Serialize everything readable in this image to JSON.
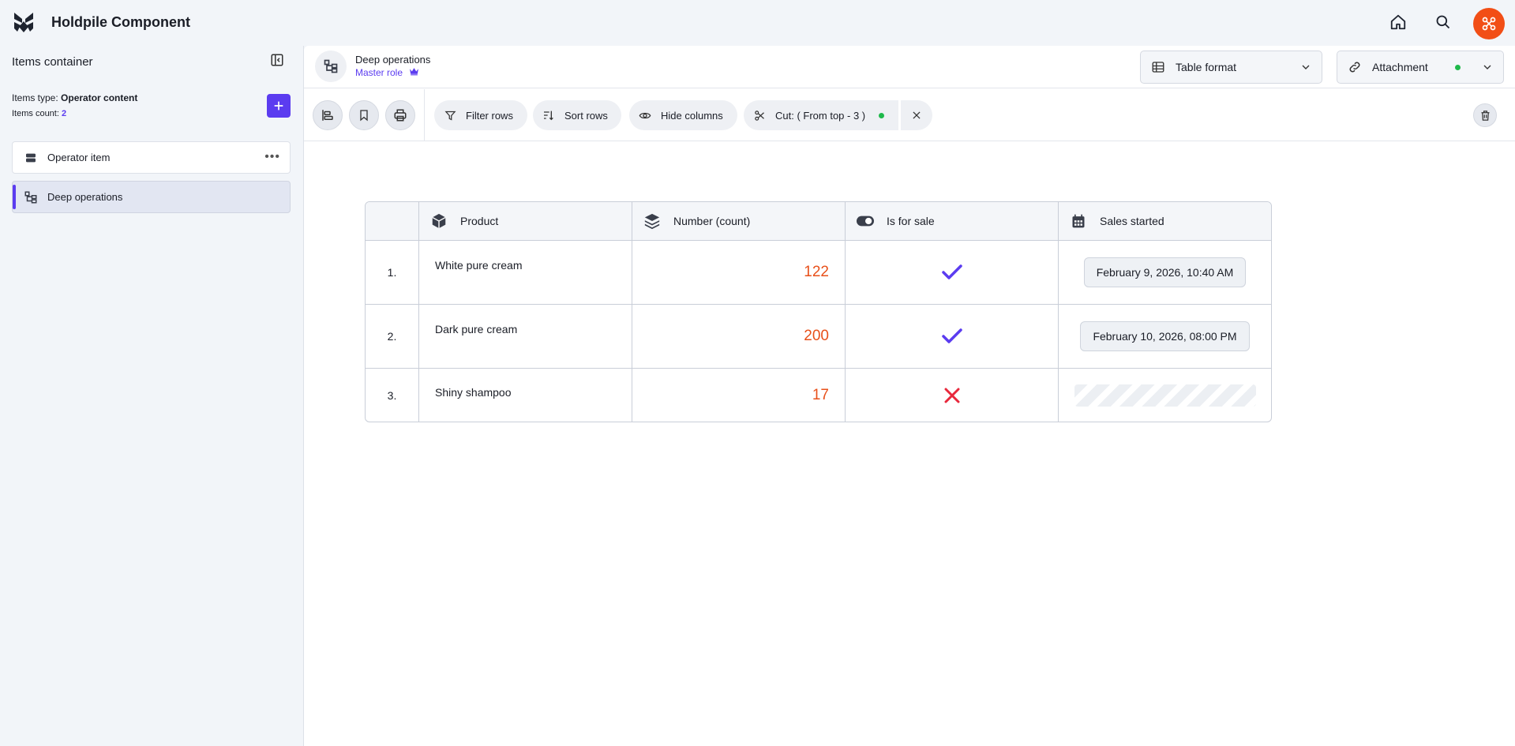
{
  "app": {
    "title": "Holdpile Component"
  },
  "sidebar": {
    "title": "Items container",
    "items_type_label": "Items type:",
    "items_type_value": "Operator content",
    "items_count_label": "Items count:",
    "items_count_value": "2",
    "items": [
      {
        "label": "Operator item",
        "icon": "database-icon"
      },
      {
        "label": "Deep operations",
        "icon": "hierarchy-icon",
        "active": true
      }
    ]
  },
  "header": {
    "title": "Deep operations",
    "role": "Master role",
    "format_select": "Table format",
    "attachment_select": "Attachment"
  },
  "toolbar": {
    "filter": "Filter rows",
    "sort": "Sort rows",
    "hide": "Hide columns",
    "cut": "Cut: ( From top - 3 )"
  },
  "table": {
    "columns": [
      "Product",
      "Number (count)",
      "Is for sale",
      "Sales started"
    ],
    "rows": [
      {
        "index": "1.",
        "product": "White pure cream",
        "count": "122",
        "for_sale": true,
        "sales_started": "February 9, 2026, 10:40 AM"
      },
      {
        "index": "2.",
        "product": "Dark pure cream",
        "count": "200",
        "for_sale": true,
        "sales_started": "February 10, 2026, 08:00 PM"
      },
      {
        "index": "3.",
        "product": "Shiny shampoo",
        "count": "17",
        "for_sale": false,
        "sales_started": ""
      }
    ]
  },
  "colors": {
    "accent": "#5b3cf0",
    "brand": "#f24e16",
    "number": "#e8501a",
    "ok": "#1fb94b",
    "error": "#e8283c"
  }
}
